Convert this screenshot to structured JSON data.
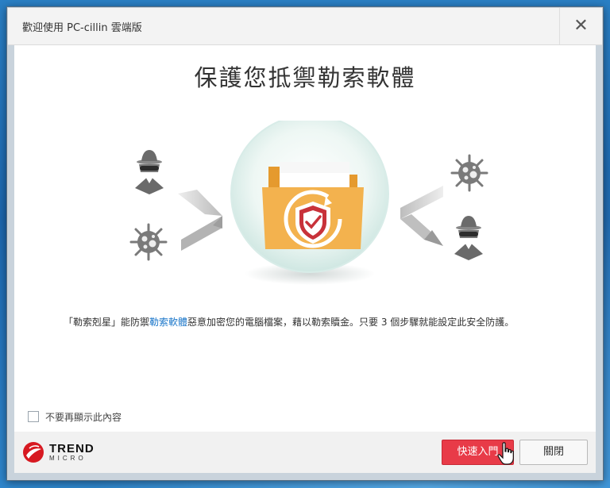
{
  "window": {
    "title": "歡迎使用 PC-cillin 雲端版",
    "close_label": "✕"
  },
  "main": {
    "headline": "保護您抵禦勒索軟體",
    "description": {
      "part1": "「勒索剋星」能防禦",
      "highlight": "勒索軟體",
      "part2": "惡意加密您的電腦檔案，藉以勒索贖金。只要 3 個步驟就能設定此安全防護。"
    },
    "illustration_icons": [
      "spy-icon",
      "virus-icon",
      "folder-shield-icon",
      "arrow-left-icon",
      "arrow-right-icon"
    ]
  },
  "options": {
    "dont_show_again": "不要再顯示此內容",
    "dont_show_checked": false
  },
  "footer": {
    "logo_top": "TREND",
    "logo_bottom": "MICRO",
    "quick_start": "快速入門",
    "close": "關閉"
  },
  "colors": {
    "primary_button": "#e83b48",
    "link_highlight": "#1a76c9",
    "folder": "#f3b24e",
    "logo_red": "#d71921"
  }
}
